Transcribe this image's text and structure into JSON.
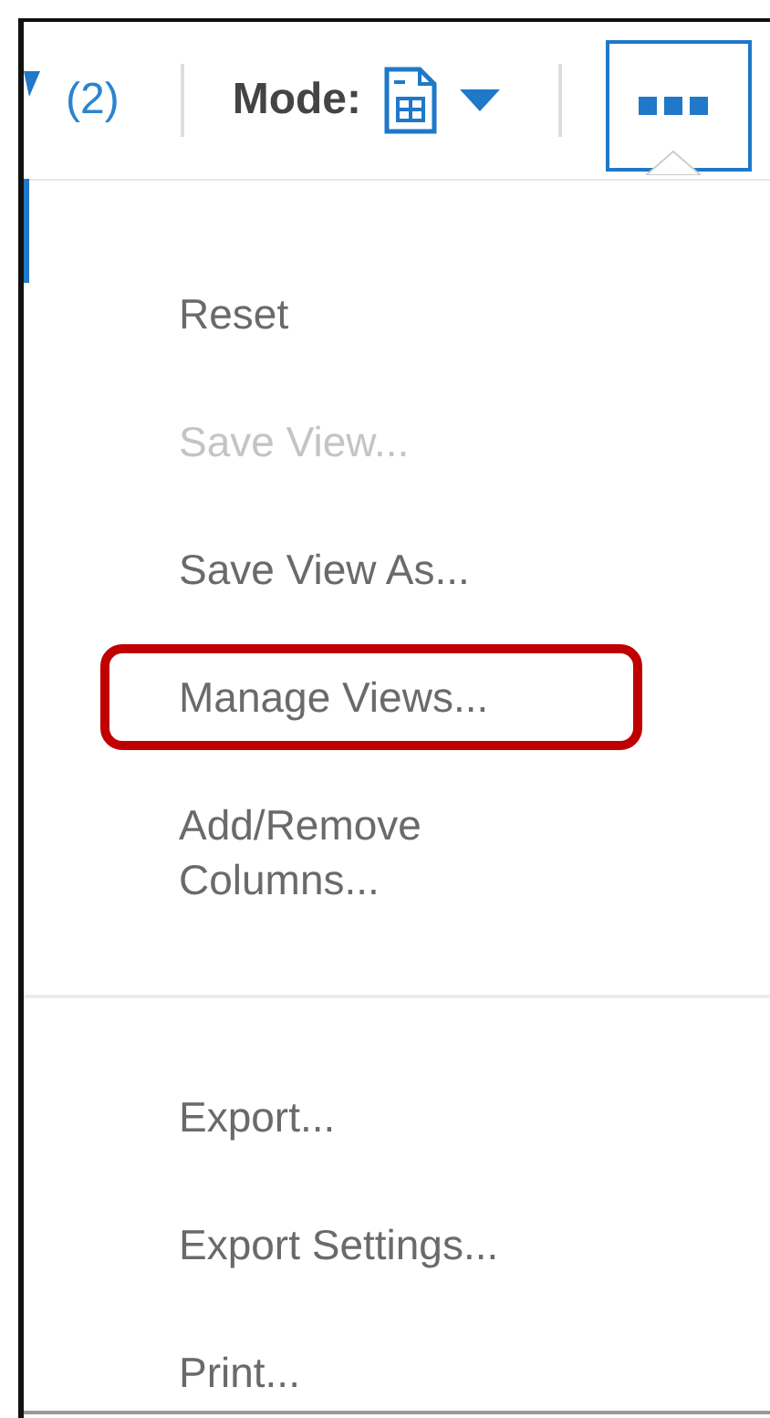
{
  "toolbar": {
    "filter_count": "(2)",
    "mode_label": "Mode:"
  },
  "menu": {
    "groups": [
      {
        "items": [
          {
            "label": "Reset",
            "disabled": false,
            "highlighted": false
          },
          {
            "label": "Save View...",
            "disabled": true,
            "highlighted": false
          },
          {
            "label": "Save View As...",
            "disabled": false,
            "highlighted": false
          },
          {
            "label": "Manage Views...",
            "disabled": false,
            "highlighted": true
          },
          {
            "label": "Add/Remove Columns...",
            "disabled": false,
            "highlighted": false
          }
        ]
      },
      {
        "items": [
          {
            "label": "Export...",
            "disabled": false,
            "highlighted": false
          },
          {
            "label": "Export Settings...",
            "disabled": false,
            "highlighted": false
          },
          {
            "label": "Print...",
            "disabled": false,
            "highlighted": false
          }
        ]
      }
    ]
  }
}
